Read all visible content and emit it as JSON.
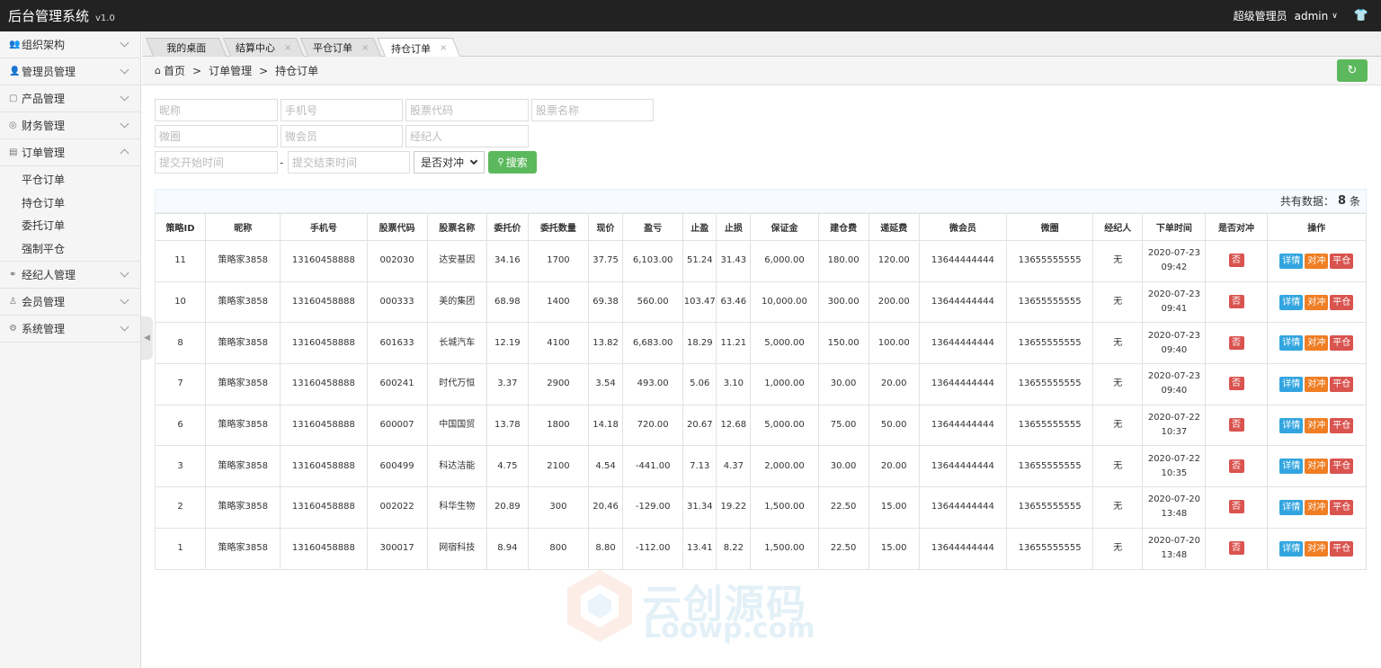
{
  "header": {
    "title": "后台管理系统",
    "version": "v1.0",
    "role": "超级管理员",
    "user": "admin"
  },
  "sidebar": {
    "items": [
      {
        "label": "组织架构"
      },
      {
        "label": "管理员管理"
      },
      {
        "label": "产品管理"
      },
      {
        "label": "财务管理"
      },
      {
        "label": "订单管理",
        "sub": [
          "平仓订单",
          "持仓订单",
          "委托订单",
          "强制平仓"
        ]
      },
      {
        "label": "经纪人管理"
      },
      {
        "label": "会员管理"
      },
      {
        "label": "系统管理"
      }
    ]
  },
  "tabs": [
    {
      "label": "我的桌面"
    },
    {
      "label": "结算中心"
    },
    {
      "label": "平仓订单"
    },
    {
      "label": "持仓订单"
    }
  ],
  "breadcrumb": {
    "home": "首页",
    "parent": "订单管理",
    "current": "持仓订单"
  },
  "filters": {
    "nickname": "昵称",
    "phone": "手机号",
    "stock_code": "股票代码",
    "stock_name": "股票名称",
    "micro_circle": "微圈",
    "micro_member": "微会员",
    "broker": "经纪人",
    "start_time": "提交开始时间",
    "end_time": "提交结束时间",
    "dash": "-",
    "hedge_select": "是否对冲",
    "search_label": "搜索"
  },
  "summary": {
    "label": "共有数据：",
    "count": "8",
    "unit": "条"
  },
  "table": {
    "headers": [
      "策略ID",
      "昵称",
      "手机号",
      "股票代码",
      "股票名称",
      "委托价",
      "委托数量",
      "现价",
      "盈亏",
      "止盈",
      "止损",
      "保证金",
      "建仓费",
      "递延费",
      "微会员",
      "微圈",
      "经纪人",
      "下单时间",
      "是否对冲",
      "操作"
    ],
    "rows": [
      {
        "id": "11",
        "nick": "策略家3858",
        "phone": "13160458888",
        "code": "002030",
        "name": "达安基因",
        "price": "34.16",
        "qty": "1700",
        "cur": "37.75",
        "pnl": "6,103.00",
        "tp": "51.24",
        "sl": "31.43",
        "margin": "6,000.00",
        "open_fee": "180.00",
        "defer_fee": "120.00",
        "member": "13644444444",
        "circle": "13655555555",
        "broker": "无",
        "date": "2020-07-23",
        "time": "09:42",
        "hedge": "否"
      },
      {
        "id": "10",
        "nick": "策略家3858",
        "phone": "13160458888",
        "code": "000333",
        "name": "美的集团",
        "price": "68.98",
        "qty": "1400",
        "cur": "69.38",
        "pnl": "560.00",
        "tp": "103.47",
        "sl": "63.46",
        "margin": "10,000.00",
        "open_fee": "300.00",
        "defer_fee": "200.00",
        "member": "13644444444",
        "circle": "13655555555",
        "broker": "无",
        "date": "2020-07-23",
        "time": "09:41",
        "hedge": "否"
      },
      {
        "id": "8",
        "nick": "策略家3858",
        "phone": "13160458888",
        "code": "601633",
        "name": "长城汽车",
        "price": "12.19",
        "qty": "4100",
        "cur": "13.82",
        "pnl": "6,683.00",
        "tp": "18.29",
        "sl": "11.21",
        "margin": "5,000.00",
        "open_fee": "150.00",
        "defer_fee": "100.00",
        "member": "13644444444",
        "circle": "13655555555",
        "broker": "无",
        "date": "2020-07-23",
        "time": "09:40",
        "hedge": "否"
      },
      {
        "id": "7",
        "nick": "策略家3858",
        "phone": "13160458888",
        "code": "600241",
        "name": "时代万恒",
        "price": "3.37",
        "qty": "2900",
        "cur": "3.54",
        "pnl": "493.00",
        "tp": "5.06",
        "sl": "3.10",
        "margin": "1,000.00",
        "open_fee": "30.00",
        "defer_fee": "20.00",
        "member": "13644444444",
        "circle": "13655555555",
        "broker": "无",
        "date": "2020-07-23",
        "time": "09:40",
        "hedge": "否"
      },
      {
        "id": "6",
        "nick": "策略家3858",
        "phone": "13160458888",
        "code": "600007",
        "name": "中国国贸",
        "price": "13.78",
        "qty": "1800",
        "cur": "14.18",
        "pnl": "720.00",
        "tp": "20.67",
        "sl": "12.68",
        "margin": "5,000.00",
        "open_fee": "75.00",
        "defer_fee": "50.00",
        "member": "13644444444",
        "circle": "13655555555",
        "broker": "无",
        "date": "2020-07-22",
        "time": "10:37",
        "hedge": "否"
      },
      {
        "id": "3",
        "nick": "策略家3858",
        "phone": "13160458888",
        "code": "600499",
        "name": "科达洁能",
        "price": "4.75",
        "qty": "2100",
        "cur": "4.54",
        "pnl": "-441.00",
        "tp": "7.13",
        "sl": "4.37",
        "margin": "2,000.00",
        "open_fee": "30.00",
        "defer_fee": "20.00",
        "member": "13644444444",
        "circle": "13655555555",
        "broker": "无",
        "date": "2020-07-22",
        "time": "10:35",
        "hedge": "否"
      },
      {
        "id": "2",
        "nick": "策略家3858",
        "phone": "13160458888",
        "code": "002022",
        "name": "科华生物",
        "price": "20.89",
        "qty": "300",
        "cur": "20.46",
        "pnl": "-129.00",
        "tp": "31.34",
        "sl": "19.22",
        "margin": "1,500.00",
        "open_fee": "22.50",
        "defer_fee": "15.00",
        "member": "13644444444",
        "circle": "13655555555",
        "broker": "无",
        "date": "2020-07-20",
        "time": "13:48",
        "hedge": "否"
      },
      {
        "id": "1",
        "nick": "策略家3858",
        "phone": "13160458888",
        "code": "300017",
        "name": "网宿科技",
        "price": "8.94",
        "qty": "800",
        "cur": "8.80",
        "pnl": "-112.00",
        "tp": "13.41",
        "sl": "8.22",
        "margin": "1,500.00",
        "open_fee": "22.50",
        "defer_fee": "15.00",
        "member": "13644444444",
        "circle": "13655555555",
        "broker": "无",
        "date": "2020-07-20",
        "time": "13:48",
        "hedge": "否"
      }
    ],
    "actions": {
      "detail": "详情",
      "hedge": "对冲",
      "close": "平仓"
    }
  },
  "watermark": {
    "cn": "云创源码",
    "en": "Loowp.com"
  },
  "colors": {
    "green": "#5cb85c",
    "red": "#d9534f",
    "blue": "#32a5e0",
    "orange": "#f07e24",
    "topbar": "#222222"
  },
  "icons": {
    "home": "home-icon",
    "refresh": "refresh-icon",
    "search": "search-icon",
    "shirt": "shirt-icon"
  }
}
